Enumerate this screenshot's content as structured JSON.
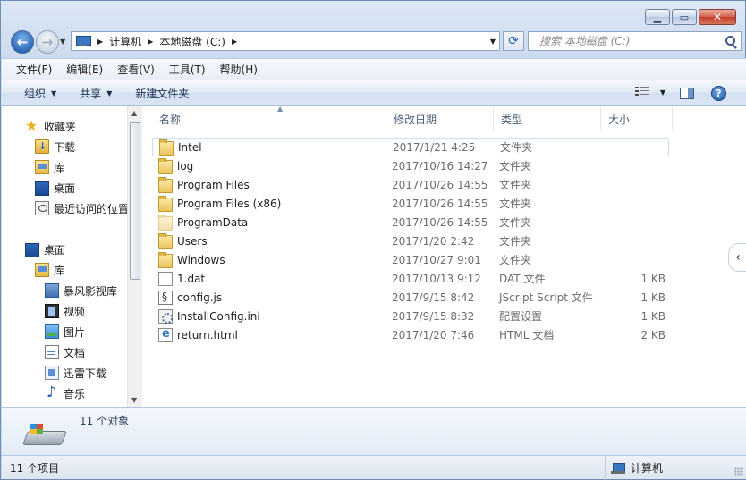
{
  "breadcrumb": [
    "计算机",
    "本地磁盘 (C:)"
  ],
  "search": {
    "placeholder": "搜索 本地磁盘 (C:)"
  },
  "menu": [
    "文件(F)",
    "编辑(E)",
    "查看(V)",
    "工具(T)",
    "帮助(H)"
  ],
  "toolbar": {
    "organize": "组织",
    "share": "共享",
    "new_folder": "新建文件夹"
  },
  "nav": {
    "favorites": "收藏夹",
    "fav_items": [
      "下载",
      "库",
      "桌面",
      "最近访问的位置"
    ],
    "desktop": "桌面",
    "library": "库",
    "lib_items": [
      "暴风影视库",
      "视频",
      "图片",
      "文档",
      "迅雷下载",
      "音乐"
    ]
  },
  "columns": {
    "name": "名称",
    "date": "修改日期",
    "type": "类型",
    "size": "大小"
  },
  "files": [
    {
      "name": "Intel",
      "date": "2017/1/21 4:25",
      "type": "文件夹",
      "size": "",
      "icon": "folder-icon"
    },
    {
      "name": "log",
      "date": "2017/10/16 14:27",
      "type": "文件夹",
      "size": "",
      "icon": "folder-icon"
    },
    {
      "name": "Program Files",
      "date": "2017/10/26 14:55",
      "type": "文件夹",
      "size": "",
      "icon": "folder-icon"
    },
    {
      "name": "Program Files (x86)",
      "date": "2017/10/26 14:55",
      "type": "文件夹",
      "size": "",
      "icon": "folder-icon"
    },
    {
      "name": "ProgramData",
      "date": "2017/10/26 14:55",
      "type": "文件夹",
      "size": "",
      "icon": "hidden-folder-icon"
    },
    {
      "name": "Users",
      "date": "2017/1/20 2:42",
      "type": "文件夹",
      "size": "",
      "icon": "folder-icon"
    },
    {
      "name": "Windows",
      "date": "2017/10/27 9:01",
      "type": "文件夹",
      "size": "",
      "icon": "folder-icon"
    },
    {
      "name": "1.dat",
      "date": "2017/10/13 9:12",
      "type": "DAT 文件",
      "size": "1 KB",
      "icon": "file-icon"
    },
    {
      "name": "config.js",
      "date": "2017/9/15 8:42",
      "type": "JScript Script 文件",
      "size": "1 KB",
      "icon": "script-file-icon"
    },
    {
      "name": "InstallConfig.ini",
      "date": "2017/9/15 8:32",
      "type": "配置设置",
      "size": "1 KB",
      "icon": "settings-file-icon"
    },
    {
      "name": "return.html",
      "date": "2017/1/20 7:46",
      "type": "HTML 文档",
      "size": "2 KB",
      "icon": "html-file-icon"
    }
  ],
  "details": {
    "count": "11 个对象"
  },
  "status": {
    "items": "11 个项目",
    "location": "计算机"
  }
}
